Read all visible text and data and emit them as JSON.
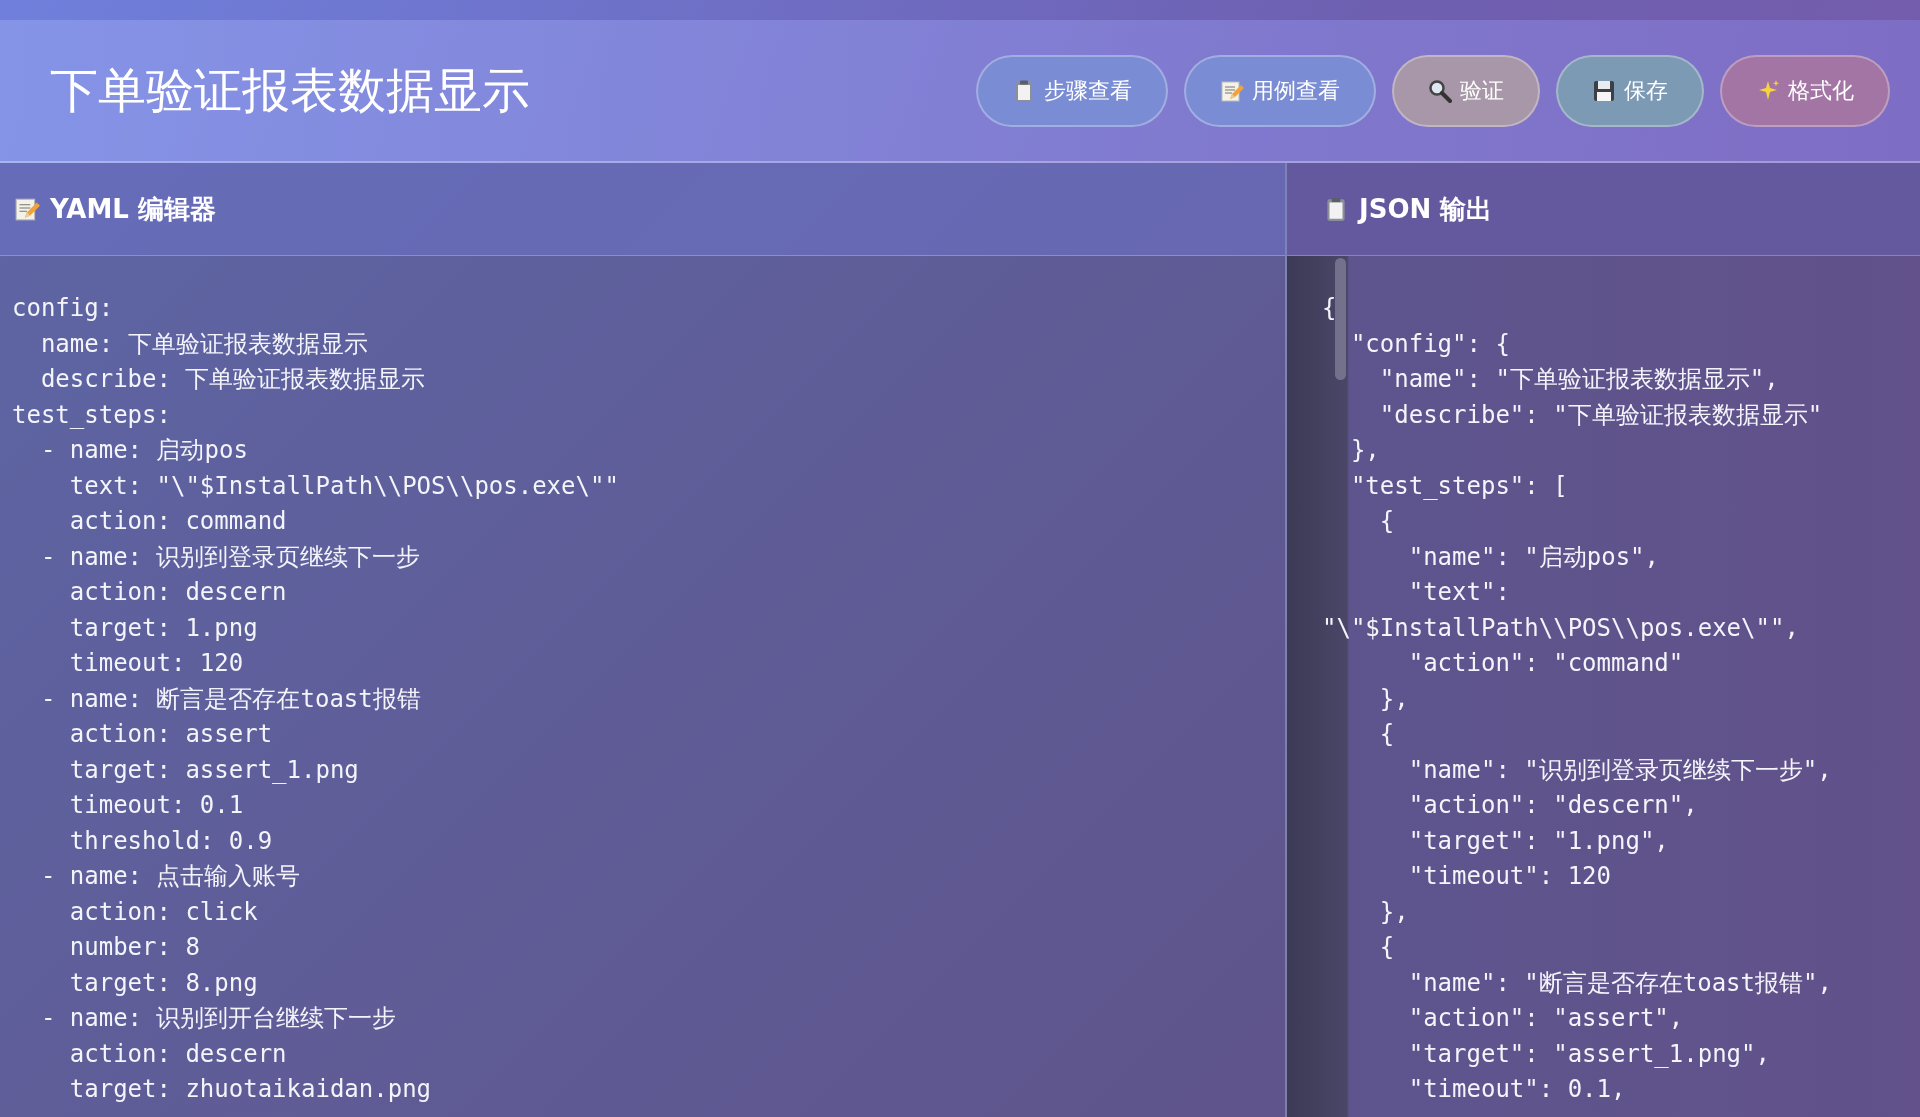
{
  "header": {
    "title": "下单验证报表数据显示",
    "buttons": [
      {
        "label": "步骤查看",
        "color": "#7a8cd4"
      },
      {
        "label": "用例查看",
        "color": "#7a8cd4"
      },
      {
        "label": "验证",
        "color": "#a797a8"
      },
      {
        "label": "保存",
        "color": "#7d9ab4"
      },
      {
        "label": "格式化",
        "color": "#a275a5"
      }
    ]
  },
  "yaml_panel": {
    "title": "YAML 编辑器",
    "lines": [
      "config:",
      "  name: 下单验证报表数据显示",
      "  describe: 下单验证报表数据显示",
      "test_steps:",
      "  - name: 启动pos",
      "    text: \"\\\"$InstallPath\\\\POS\\\\pos.exe\\\"\"",
      "    action: command",
      "  - name: 识别到登录页继续下一步",
      "    action: descern",
      "    target: 1.png",
      "    timeout: 120",
      "  - name: 断言是否存在toast报错",
      "    action: assert",
      "    target: assert_1.png",
      "    timeout: 0.1",
      "    threshold: 0.9",
      "  - name: 点击输入账号",
      "    action: click",
      "    number: 8",
      "    target: 8.png",
      "  - name: 识别到开台继续下一步",
      "    action: descern",
      "    target: zhuotaikaidan.png"
    ]
  },
  "json_panel": {
    "title": "JSON 输出",
    "lines": [
      "{",
      "  \"config\": {",
      "    \"name\": \"下单验证报表数据显示\",",
      "    \"describe\": \"下单验证报表数据显示\"",
      "  },",
      "  \"test_steps\": [",
      "    {",
      "      \"name\": \"启动pos\",",
      "      \"text\":",
      "\"\\\"$InstallPath\\\\POS\\\\pos.exe\\\"\",",
      "      \"action\": \"command\"",
      "    },",
      "    {",
      "      \"name\": \"识别到登录页继续下一步\",",
      "      \"action\": \"descern\",",
      "      \"target\": \"1.png\",",
      "      \"timeout\": 120",
      "    },",
      "    {",
      "      \"name\": \"断言是否存在toast报错\",",
      "      \"action\": \"assert\",",
      "      \"target\": \"assert_1.png\",",
      "      \"timeout\": 0.1,"
    ]
  }
}
